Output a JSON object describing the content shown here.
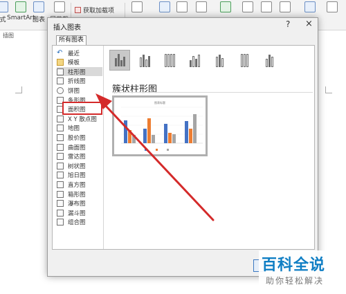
{
  "ribbon": {
    "smartart_label": "SmartArt",
    "chart_label": "图表",
    "screenshot_label": "屏幕截",
    "get_addins_label": "获取加载项",
    "group_label": "插图"
  },
  "dialog": {
    "title": "插入图表",
    "help": "?",
    "close": "×",
    "tab_all": "所有图表",
    "selected_subtype_title": "簇状柱形图",
    "preview_chart_title": "图表标题",
    "sidebar_items": [
      {
        "label": "最近",
        "icon": "undo-icon"
      },
      {
        "label": "模板",
        "icon": "folder-icon"
      },
      {
        "label": "柱形图",
        "icon": "column-chart-icon"
      },
      {
        "label": "折线图",
        "icon": "line-chart-icon"
      },
      {
        "label": "饼图",
        "icon": "pie-chart-icon"
      },
      {
        "label": "条形图",
        "icon": "bar-chart-icon"
      },
      {
        "label": "面积图",
        "icon": "area-chart-icon"
      },
      {
        "label": "X Y 散点图",
        "icon": "scatter-chart-icon"
      },
      {
        "label": "地图",
        "icon": "map-chart-icon"
      },
      {
        "label": "股价图",
        "icon": "stock-chart-icon"
      },
      {
        "label": "曲面图",
        "icon": "surface-chart-icon"
      },
      {
        "label": "雷达图",
        "icon": "radar-chart-icon"
      },
      {
        "label": "树状图",
        "icon": "treemap-chart-icon"
      },
      {
        "label": "旭日图",
        "icon": "sunburst-chart-icon"
      },
      {
        "label": "直方图",
        "icon": "histogram-chart-icon"
      },
      {
        "label": "箱形图",
        "icon": "box-whisker-chart-icon"
      },
      {
        "label": "瀑布图",
        "icon": "waterfall-chart-icon"
      },
      {
        "label": "漏斗图",
        "icon": "funnel-chart-icon"
      },
      {
        "label": "组合图",
        "icon": "combo-chart-icon"
      }
    ]
  },
  "colors": {
    "highlight": "#d42a2a",
    "series1": "#4472c4",
    "series2": "#ed7d31",
    "series3": "#a5a5a5"
  },
  "watermark": {
    "main": "百科全说",
    "sub": "助你轻松解决"
  }
}
